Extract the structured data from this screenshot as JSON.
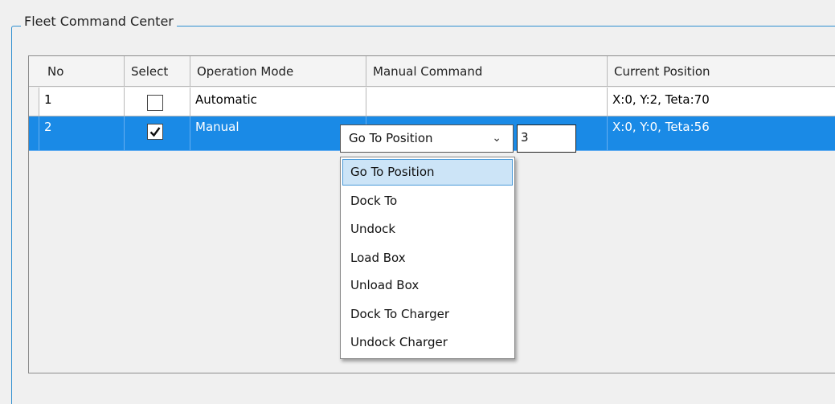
{
  "group": {
    "title": "Fleet Command Center"
  },
  "columns": [
    "No",
    "Select",
    "Operation Mode",
    "Manual Command",
    "Current Position"
  ],
  "rows": [
    {
      "no": "1",
      "selected": false,
      "mode": "Automatic",
      "command": "",
      "position": "X:0, Y:2, Teta:70"
    },
    {
      "no": "2",
      "selected": true,
      "mode": "Manual",
      "command": "Go To Position",
      "position": "X:0, Y:0, Teta:56"
    }
  ],
  "editor": {
    "combo_value": "Go To Position",
    "arrow_icon": "chevron-down-icon",
    "number_value": "3"
  },
  "dropdown": {
    "selected_index": 0,
    "options": [
      "Go To Position",
      "Dock To",
      "Undock",
      "Load Box",
      "Unload Box",
      "Dock To Charger",
      "Undock Charger"
    ]
  },
  "colors": {
    "selection": "#1a8ae6",
    "accent": "#2e8fd0"
  }
}
